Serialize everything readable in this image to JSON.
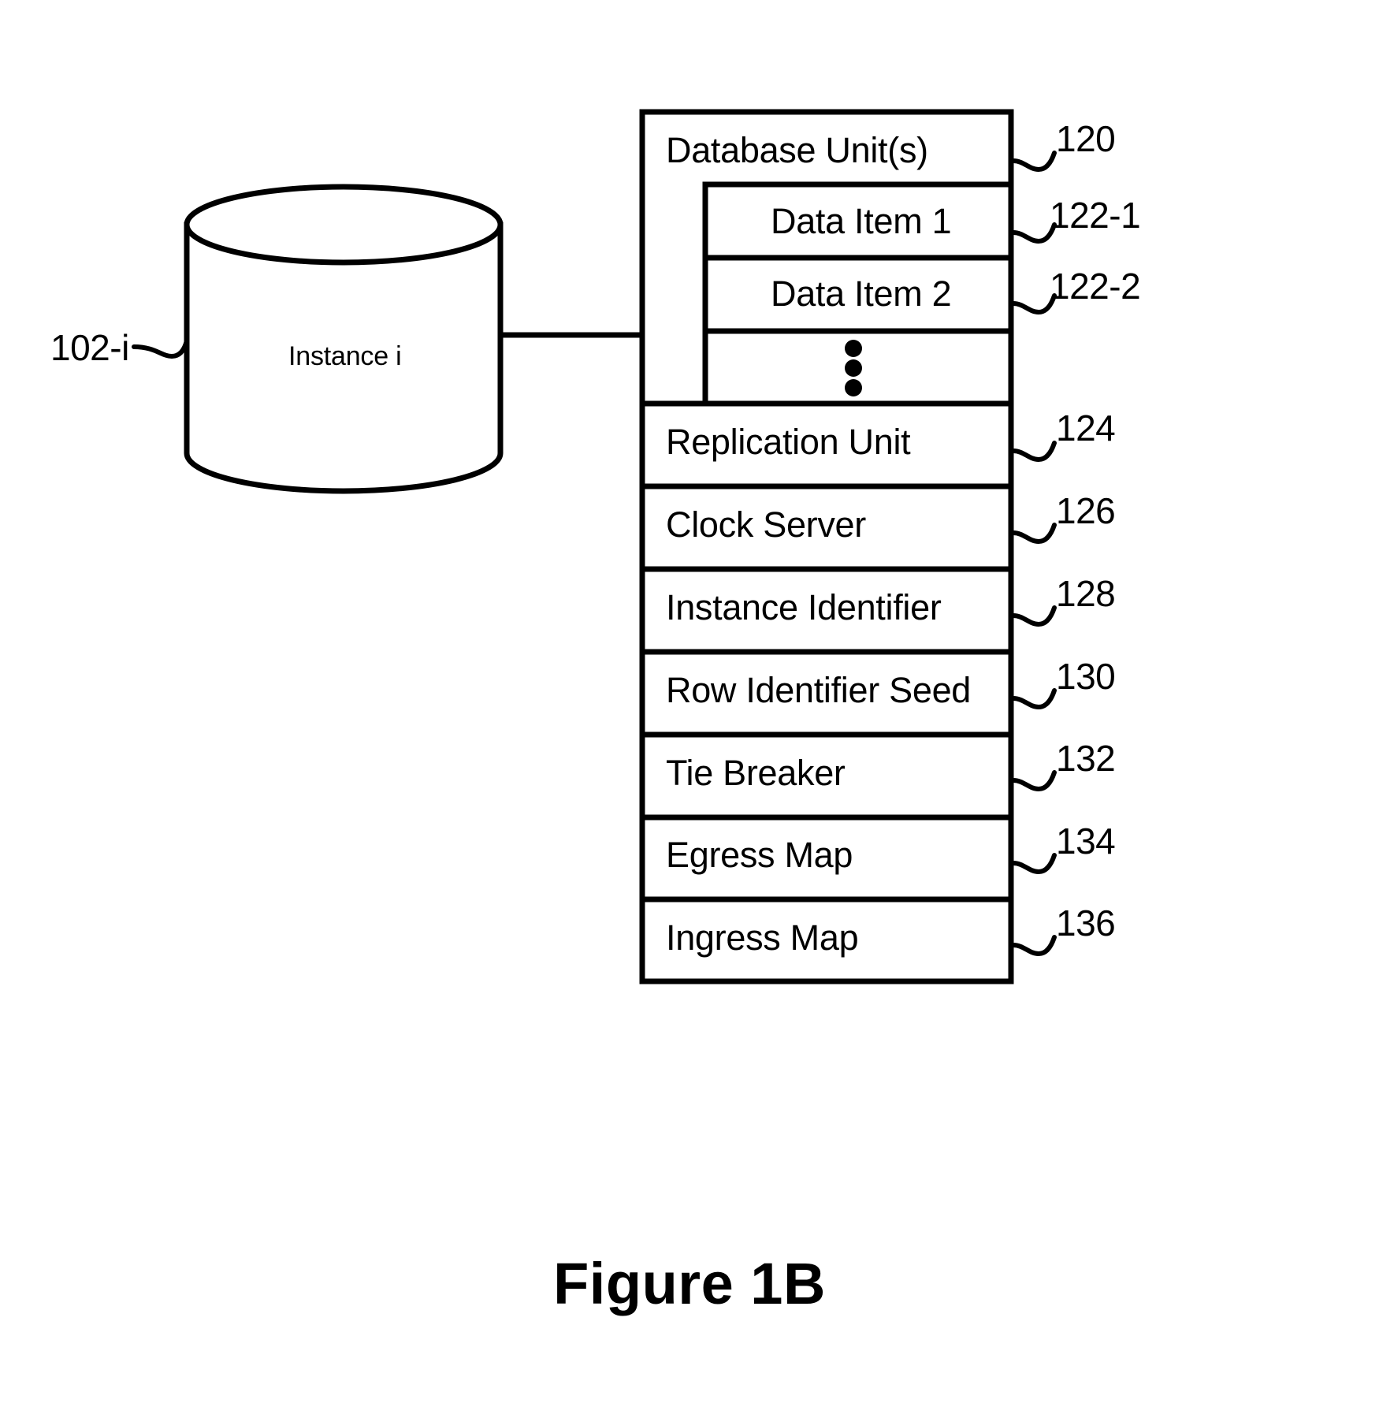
{
  "figure": {
    "caption": "Figure 1B"
  },
  "instance": {
    "label": "Instance i",
    "ref": "102-i"
  },
  "database_unit": {
    "title": "Database Unit(s)",
    "ref": "120",
    "items": [
      {
        "label": "Data Item 1",
        "ref": "122-1"
      },
      {
        "label": "Data Item 2",
        "ref": "122-2"
      },
      {
        "label": "⋮",
        "ref": ""
      }
    ]
  },
  "components": [
    {
      "label": "Replication Unit",
      "ref": "124"
    },
    {
      "label": "Clock Server",
      "ref": "126"
    },
    {
      "label": "Instance Identifier",
      "ref": "128"
    },
    {
      "label": "Row Identifier Seed",
      "ref": "130"
    },
    {
      "label": "Tie Breaker",
      "ref": "132"
    },
    {
      "label": "Egress Map",
      "ref": "134"
    },
    {
      "label": "Ingress Map",
      "ref": "136"
    }
  ],
  "style": {
    "line_color": "#000000",
    "background": "#ffffff"
  }
}
